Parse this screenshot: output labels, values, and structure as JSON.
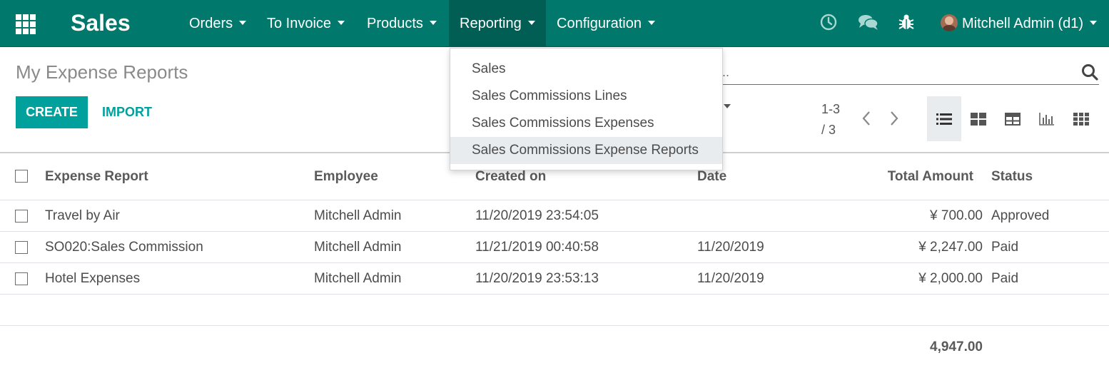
{
  "navbar": {
    "brand": "Sales",
    "menus": [
      {
        "label": "Orders"
      },
      {
        "label": "To Invoice"
      },
      {
        "label": "Products"
      },
      {
        "label": "Reporting"
      },
      {
        "label": "Configuration"
      }
    ],
    "user": "Mitchell Admin (d1)",
    "colors": {
      "bar": "#00786c",
      "active": "#005e55"
    }
  },
  "reporting_dropdown": {
    "items": [
      {
        "label": "Sales"
      },
      {
        "label": "Sales Commissions Lines"
      },
      {
        "label": "Sales Commissions Expenses"
      },
      {
        "label": "Sales Commissions Expense Reports"
      }
    ]
  },
  "control_panel": {
    "breadcrumb": "My Expense Reports",
    "create_label": "CREATE",
    "import_label": "IMPORT",
    "search_placeholder": "..",
    "pager_range": "1-3",
    "pager_total": "/ 3",
    "accent": "#00a09d"
  },
  "table": {
    "columns": [
      "Expense Report",
      "Employee",
      "Created on",
      "Date",
      "Total Amount",
      "Status"
    ],
    "rows": [
      {
        "report": "Travel by Air",
        "employee": "Mitchell Admin",
        "created": "11/20/2019 23:54:05",
        "date": "",
        "amount": "¥ 700.00",
        "status": "Approved"
      },
      {
        "report": "SO020:Sales Commission",
        "employee": "Mitchell Admin",
        "created": "11/21/2019 00:40:58",
        "date": "11/20/2019",
        "amount": "¥ 2,247.00",
        "status": "Paid"
      },
      {
        "report": "Hotel Expenses",
        "employee": "Mitchell Admin",
        "created": "11/20/2019 23:53:13",
        "date": "11/20/2019",
        "amount": "¥ 2,000.00",
        "status": "Paid"
      }
    ],
    "total": "4,947.00"
  }
}
